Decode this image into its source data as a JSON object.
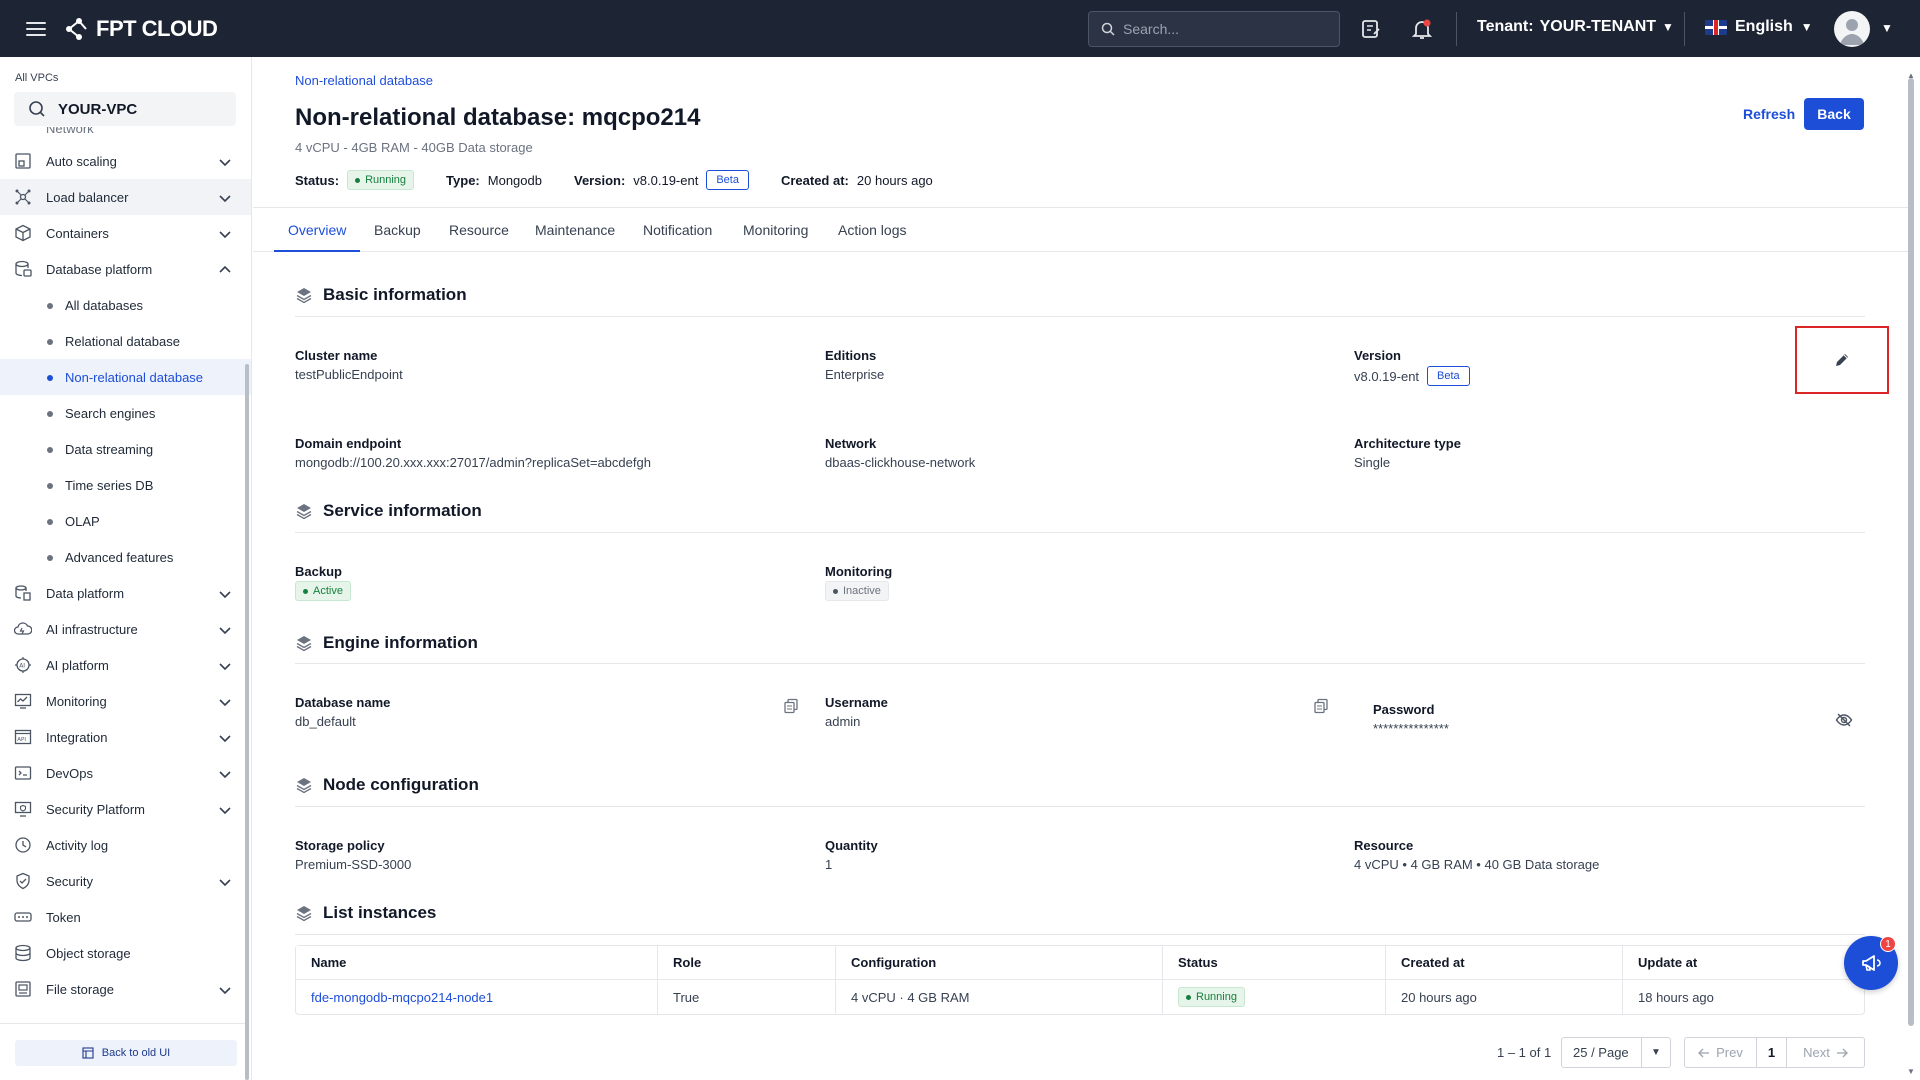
{
  "topbar": {
    "brand": "FPT CLOUD",
    "search_placeholder": "Search...",
    "tenant_label": "Tenant:",
    "tenant_value": "YOUR-TENANT",
    "language": "English"
  },
  "sidebar": {
    "vpc_label": "All VPCs",
    "vpc_value": "YOUR-VPC",
    "partial_item": "Network",
    "items": [
      {
        "label": "Auto scaling"
      },
      {
        "label": "Load balancer"
      },
      {
        "label": "Containers"
      },
      {
        "label": "Database platform"
      }
    ],
    "sub_items": [
      {
        "label": "All databases"
      },
      {
        "label": "Relational database"
      },
      {
        "label": "Non-relational database"
      },
      {
        "label": "Search engines"
      },
      {
        "label": "Data streaming"
      },
      {
        "label": "Time series DB"
      },
      {
        "label": "OLAP"
      },
      {
        "label": "Advanced features"
      }
    ],
    "items_after": [
      {
        "label": "Data platform"
      },
      {
        "label": "AI infrastructure"
      },
      {
        "label": "AI platform"
      },
      {
        "label": "Monitoring"
      },
      {
        "label": "Integration"
      },
      {
        "label": "DevOps"
      },
      {
        "label": "Security Platform"
      },
      {
        "label": "Activity log"
      },
      {
        "label": "Security"
      },
      {
        "label": "Token"
      },
      {
        "label": "Object storage"
      },
      {
        "label": "File storage"
      }
    ],
    "back_old_ui": "Back to old UI"
  },
  "header": {
    "breadcrumb": "Non-relational database",
    "title": "Non-relational database: mqcpo214",
    "subtitle": "4 vCPU - 4GB RAM - 40GB Data storage",
    "status_label": "Status:",
    "status_value": "Running",
    "type_label": "Type:",
    "type_value": "Mongodb",
    "version_label": "Version:",
    "version_value": "v8.0.19-ent",
    "version_badge": "Beta",
    "created_label": "Created at:",
    "created_value": "20 hours ago",
    "refresh": "Refresh",
    "back": "Back"
  },
  "tabs": [
    "Overview",
    "Backup",
    "Resource",
    "Maintenance",
    "Notification",
    "Monitoring",
    "Action logs"
  ],
  "basic": {
    "title": "Basic information",
    "cluster_name_label": "Cluster name",
    "cluster_name": "testPublicEndpoint",
    "editions_label": "Editions",
    "editions": "Enterprise",
    "version_label": "Version",
    "version": "v8.0.19-ent",
    "version_badge": "Beta",
    "domain_label": "Domain endpoint",
    "domain": "mongodb://100.20.xxx.xxx:27017/admin?replicaSet=abcdefgh",
    "network_label": "Network",
    "network": "dbaas-clickhouse-network",
    "arch_label": "Architecture type",
    "arch": "Single"
  },
  "service": {
    "title": "Service information",
    "backup_label": "Backup",
    "backup_status": "Active",
    "monitoring_label": "Monitoring",
    "monitoring_status": "Inactive"
  },
  "engine": {
    "title": "Engine information",
    "dbname_label": "Database name",
    "dbname": "db_default",
    "username_label": "Username",
    "username": "admin",
    "password_label": "Password",
    "password": "***************"
  },
  "node": {
    "title": "Node configuration",
    "storage_label": "Storage policy",
    "storage": "Premium-SSD-3000",
    "quantity_label": "Quantity",
    "quantity": "1",
    "resource_label": "Resource",
    "resource": "4 vCPU • 4 GB RAM • 40 GB Data storage"
  },
  "instances": {
    "title": "List instances",
    "columns": [
      "Name",
      "Role",
      "Configuration",
      "Status",
      "Created at",
      "Update at"
    ],
    "rows": [
      {
        "name": "fde-mongodb-mqcpo214-node1",
        "role": "True",
        "config": "4 vCPU · 4 GB RAM",
        "status": "Running",
        "created": "20 hours ago",
        "updated": "18 hours ago"
      }
    ]
  },
  "pagination": {
    "range": "1 – 1 of 1",
    "page_size": "25 / Page",
    "prev": "Prev",
    "page": "1",
    "next": "Next"
  },
  "fab_badge": "1",
  "colors": {
    "topbar": "#1d2433",
    "accent": "#1d4ed8",
    "running_green": "#15803d",
    "highlight_red": "#dc2626"
  }
}
